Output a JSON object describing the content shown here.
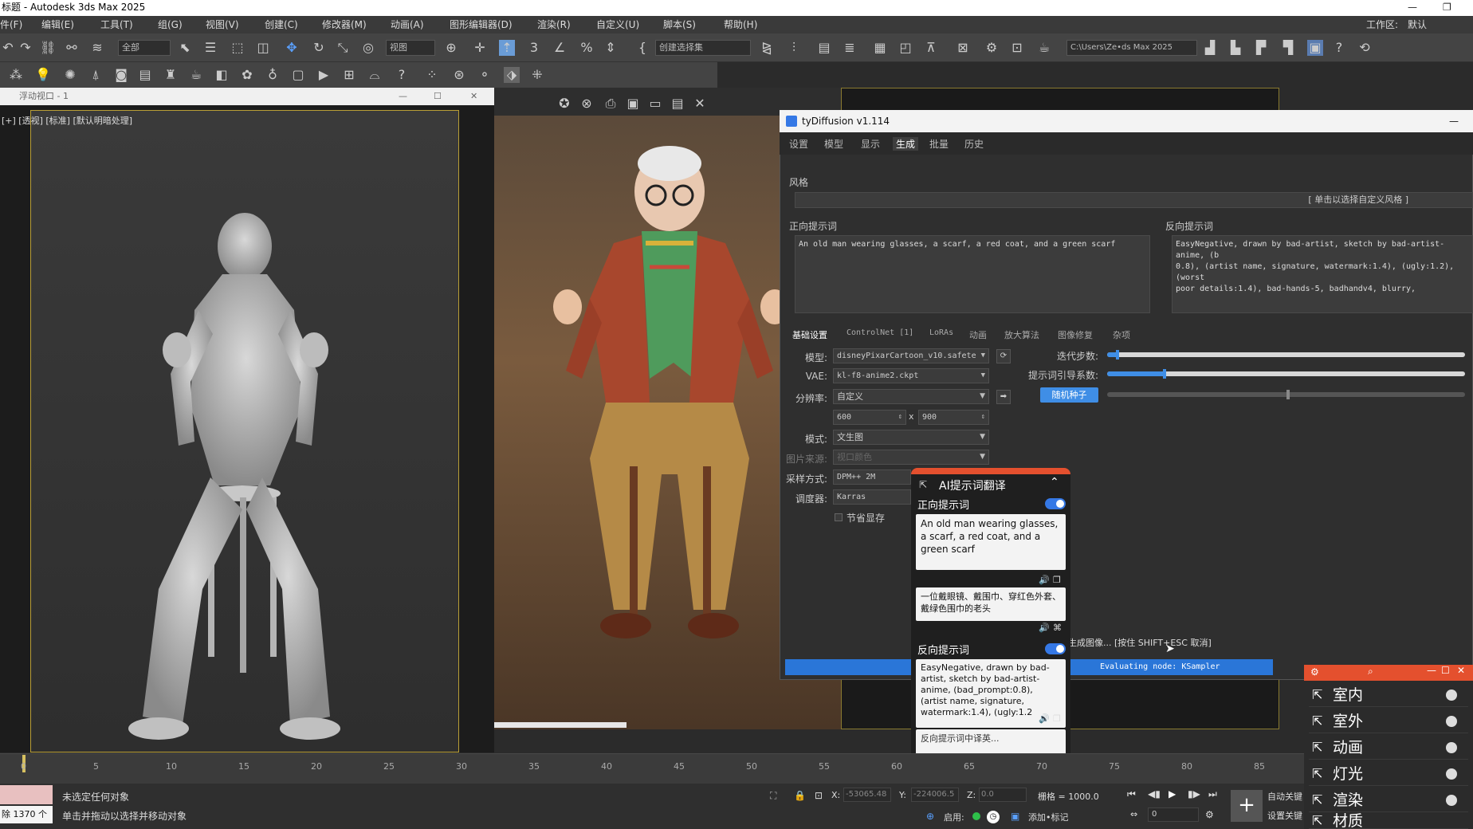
{
  "window": {
    "title": "标题 - Autodesk 3ds Max 2025"
  },
  "menu": {
    "items": [
      "件(F)",
      "编辑(E)",
      "工具(T)",
      "组(G)",
      "视图(V)",
      "创建(C)",
      "修改器(M)",
      "动画(A)",
      "图形编辑器(D)",
      "渲染(R)",
      "自定义(U)",
      "脚本(S)",
      "帮助(H)"
    ],
    "workspace_label": "工作区:",
    "workspace_value": "默认"
  },
  "toolbar": {
    "selection_filter": "全部",
    "ref_coord": "视图",
    "named_selection": "创建选择集",
    "project_path": "C:\\Users\\Ze•ds Max 2025"
  },
  "viewport_float": {
    "title": "浮动视口 - 1",
    "label": "[+] [透视] [标准] [默认明暗处理]"
  },
  "tydiffusion": {
    "title": "tyDiffusion v1.114",
    "tabs": [
      "设置",
      "模型",
      "显示",
      "生成",
      "批量",
      "历史"
    ],
    "active_tab": "生成",
    "style_label": "风格",
    "style_button": "[ 单击以选择自定义风格 ]",
    "positive_label": "正向提示词",
    "positive_prompt": "An old man wearing glasses, a scarf, a red coat, and a green scarf",
    "negative_label": "反向提示词",
    "negative_prompt": "EasyNegative, drawn by bad-artist, sketch by bad-artist-anime, (b\n0.8), (artist name, signature, watermark:1.4), (ugly:1.2), (worst\npoor details:1.4), bad-hands-5, badhandv4, blurry,",
    "subtabs": [
      "基础设置",
      "ControlNet [1]",
      "LoRAs",
      "动画",
      "放大算法",
      "图像修复",
      "杂项"
    ],
    "model_label": "模型:",
    "model_value": "disneyPixarCartoon_v10.safete",
    "vae_label": "VAE:",
    "vae_value": "kl-f8-anime2.ckpt",
    "resolution_label": "分辨率:",
    "resolution_value": "自定义",
    "width": "600",
    "x_sep": "x",
    "height": "900",
    "mode_label": "模式:",
    "mode_value": "文生图",
    "image_source_label": "图片来源:",
    "image_source_value": "视口颜色",
    "sampler_label": "采样方式:",
    "sampler_value": "DPM++ 2M",
    "scheduler_label": "调度器:",
    "scheduler_value": "Karras",
    "vram_label": "节省显存",
    "steps_label": "迭代步数:",
    "cfg_label": "提示词引导系数:",
    "seed_button": "随机种子",
    "steps_fraction": 0.03,
    "cfg_fraction": 0.16,
    "seed_fraction": 0.5,
    "generating_status": "生成图像...  [按住 SHIFT+ESC 取消]",
    "evaluating": "Evaluating node: KSampler"
  },
  "ai_panel": {
    "title": "AI提示词翻译",
    "positive_label": "正向提示词",
    "positive_en": "An old man wearing glasses, a scarf, a red coat, and a green scarf",
    "positive_zh": "一位戴眼镜、戴围巾、穿红色外套、戴绿色围巾的老头",
    "negative_label": "反向提示词",
    "negative_en": "EasyNegative, drawn by bad-artist, sketch by bad-artist-anime, (bad_prompt:0.8), (artist name, signature, watermark:1.4), (ugly:1.2",
    "negative_zh": "反向提示词中译英..."
  },
  "timeline": {
    "ticks": [
      "0",
      "5",
      "10",
      "15",
      "20",
      "25",
      "30",
      "35",
      "40",
      "45",
      "50",
      "55",
      "60",
      "65",
      "70",
      "75",
      "80",
      "85"
    ]
  },
  "status": {
    "selection": "未选定任何对象",
    "hint": "单击并拖动以选择并移动对象",
    "left_count": "除 1370 个",
    "x_label": "X:",
    "x_value": "-53065.48",
    "y_label": "Y:",
    "y_value": "-224006.5",
    "z_label": "Z:",
    "z_value": "0.0",
    "grid_label": "栅格 = 1000.0",
    "enable_label": "启用:",
    "add_tag": "添加•标记",
    "auto_key": "自动关键",
    "set_key": "设置关键",
    "frame": "0"
  },
  "mini_panel": {
    "items": [
      "室内",
      "室外",
      "动画",
      "灯光",
      "渲染",
      "材质"
    ]
  },
  "colors": {
    "accent": "#3578e5",
    "brand_orange": "#e4502e",
    "viewport_frame": "#b99f36"
  }
}
